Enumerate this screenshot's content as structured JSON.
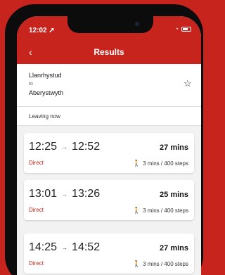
{
  "status_bar": {
    "time": "12:02 ➚"
  },
  "header": {
    "back_glyph": "‹",
    "title": "Results"
  },
  "journey": {
    "origin": "Llanrhystud",
    "connector": "to",
    "destination": "Aberystwyth"
  },
  "leaving": "Leaving now",
  "results": [
    {
      "depart": "12:25",
      "arrive": "12:52",
      "duration": "27 mins",
      "type": "Direct",
      "walk": "3 mins / 400 steps"
    },
    {
      "depart": "13:01",
      "arrive": "13:26",
      "duration": "25 mins",
      "type": "Direct",
      "walk": "3 mins / 400 steps"
    },
    {
      "depart": "14:25",
      "arrive": "14:52",
      "duration": "27 mins",
      "type": "Direct",
      "walk": "3 mins / 400 steps"
    }
  ],
  "colors": {
    "brand_red": "#c7241d",
    "background": "#f2f2f2"
  },
  "icons": {
    "back": "chevron-left-icon",
    "favorite": "star-outline-icon",
    "walk": "walking-person-icon",
    "wifi": "wifi-icon",
    "battery": "battery-icon"
  }
}
